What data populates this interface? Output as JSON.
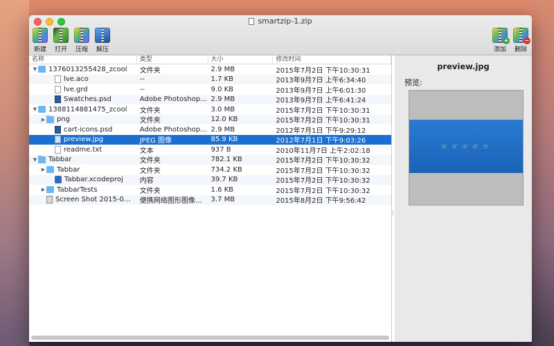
{
  "window": {
    "title": "smartzip-1.zip"
  },
  "toolbar": {
    "left": [
      {
        "label": "新建",
        "icon": "new-archive-icon"
      },
      {
        "label": "打开",
        "icon": "open-archive-icon"
      },
      {
        "label": "压缩",
        "icon": "compress-icon"
      },
      {
        "label": "解压",
        "icon": "extract-icon"
      }
    ],
    "right": [
      {
        "label": "添加",
        "icon": "add-file-icon"
      },
      {
        "label": "删除",
        "icon": "delete-file-icon"
      }
    ]
  },
  "columns": {
    "name": "名称",
    "type": "类型",
    "size": "大小",
    "date": "修改时间"
  },
  "rows": [
    {
      "name": "1376013255428_zcool",
      "type": "文件夹",
      "size": "2.9 MB",
      "date": "2015年7月2日 下午10:30:31",
      "indent": 0,
      "expander": "▼",
      "icon": "folder-icon"
    },
    {
      "name": "lve.aco",
      "type": "--",
      "size": "1.7 KB",
      "date": "2013年9月7日 上午6:34:40",
      "indent": 2,
      "expander": "",
      "icon": "file-icon"
    },
    {
      "name": "lve.grd",
      "type": "--",
      "size": "9.0 KB",
      "date": "2013年9月7日 上午6:01:30",
      "indent": 2,
      "expander": "",
      "icon": "file-icon"
    },
    {
      "name": "Swatches.psd",
      "type": "Adobe Photoshop…",
      "size": "2.9 MB",
      "date": "2013年9月7日 上午6:41:24",
      "indent": 2,
      "expander": "",
      "icon": "psd-icon"
    },
    {
      "name": "1388114881475_zcool",
      "type": "文件夹",
      "size": "3.0 MB",
      "date": "2015年7月2日 下午10:30:31",
      "indent": 0,
      "expander": "▼",
      "icon": "folder-icon"
    },
    {
      "name": "png",
      "type": "文件夹",
      "size": "12.0 KB",
      "date": "2015年7月2日 下午10:30:31",
      "indent": 1,
      "expander": "▶",
      "icon": "folder-icon"
    },
    {
      "name": "cart-icons.psd",
      "type": "Adobe Photoshop…",
      "size": "2.9 MB",
      "date": "2012年7月1日 下午9:29:12",
      "indent": 2,
      "expander": "",
      "icon": "psd-icon"
    },
    {
      "name": "preview.jpg",
      "type": "JPEG 图像",
      "size": "85.9 KB",
      "date": "2012年7月1日 下午9:03:26",
      "indent": 2,
      "expander": "",
      "icon": "image-icon",
      "selected": true
    },
    {
      "name": "readme.txt",
      "type": "文本",
      "size": "937 B",
      "date": "2010年11月7日 上午2:02:18",
      "indent": 2,
      "expander": "",
      "icon": "text-file-icon"
    },
    {
      "name": "Tabbar",
      "type": "文件夹",
      "size": "782.1 KB",
      "date": "2015年7月2日 下午10:30:32",
      "indent": 0,
      "expander": "▼",
      "icon": "folder-icon"
    },
    {
      "name": "Tabbar",
      "type": "文件夹",
      "size": "734.2 KB",
      "date": "2015年7月2日 下午10:30:32",
      "indent": 1,
      "expander": "▶",
      "icon": "folder-icon"
    },
    {
      "name": "Tabbar.xcodeproj",
      "type": "内容",
      "size": "39.7 KB",
      "date": "2015年7月2日 下午10:30:32",
      "indent": 2,
      "expander": "",
      "icon": "xcodeproj-icon"
    },
    {
      "name": "TabbarTests",
      "type": "文件夹",
      "size": "1.6 KB",
      "date": "2015年7月2日 下午10:30:32",
      "indent": 1,
      "expander": "▶",
      "icon": "folder-icon"
    },
    {
      "name": "Screen Shot 2015-0…",
      "type": "便携网络图形图像…",
      "size": "3.7 MB",
      "date": "2015年8月2日 下午9:56:42",
      "indent": 1,
      "expander": "",
      "icon": "screenshot-icon"
    }
  ],
  "preview": {
    "filename": "preview.jpg",
    "label": "预览:"
  },
  "colors": {
    "selection": "#1b6fd1",
    "folder": "#6eb6ee",
    "preview_bg": "#e9e9e9"
  }
}
